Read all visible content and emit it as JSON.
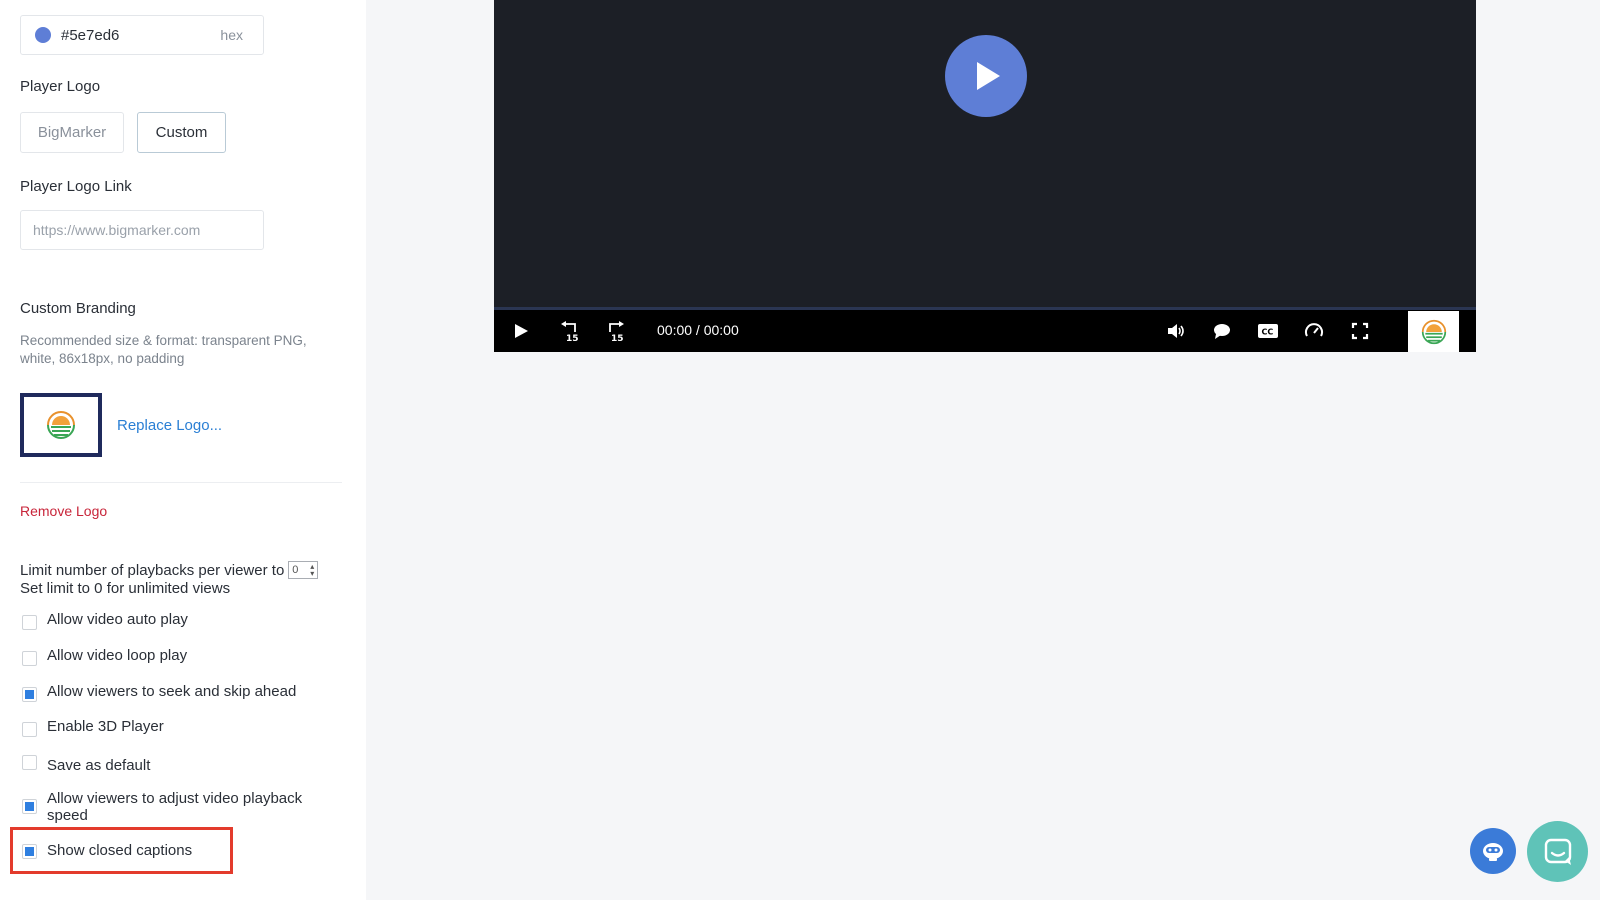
{
  "settings": {
    "brand_color": {
      "value": "#5e7ed6",
      "suffix": "hex",
      "swatch": "#5e7ed6"
    },
    "player_logo": {
      "label": "Player Logo",
      "options": [
        "BigMarker",
        "Custom"
      ],
      "selected": "Custom"
    },
    "player_logo_link": {
      "label": "Player Logo Link",
      "placeholder": "https://www.bigmarker.com"
    },
    "custom_branding": {
      "label": "Custom Branding",
      "help": "Recommended size & format: transparent PNG, white, 86x18px, no padding",
      "replace_label": "Replace Logo...",
      "remove_label": "Remove Logo"
    },
    "playback_limit": {
      "label": "Limit number of playbacks per viewer to",
      "value": "0",
      "help": "Set limit to 0 for unlimited views"
    },
    "options": [
      {
        "label": "Allow video auto play",
        "checked": false
      },
      {
        "label": "Allow video loop play",
        "checked": false
      },
      {
        "label": "Allow viewers to seek and skip ahead",
        "checked": true
      },
      {
        "label": "Enable 3D Player",
        "checked": false
      },
      {
        "label": "Save as default",
        "checked": false
      },
      {
        "label": "Allow viewers to adjust video playback speed",
        "checked": true
      },
      {
        "label": "Show closed captions",
        "checked": true
      }
    ]
  },
  "player": {
    "time": "00:00 / 00:00",
    "progress": 0,
    "accent": "#5e7ed6",
    "controls": [
      "play-icon",
      "rewind-15-icon",
      "forward-15-icon",
      "volume-icon",
      "chat-icon",
      "cc-icon",
      "speed-icon",
      "fullscreen-icon"
    ]
  },
  "colors": {
    "highlight": "#e33b2c",
    "link": "#2a7fd4",
    "danger": "#c8253a",
    "checkbox": "#2f7fe0"
  }
}
